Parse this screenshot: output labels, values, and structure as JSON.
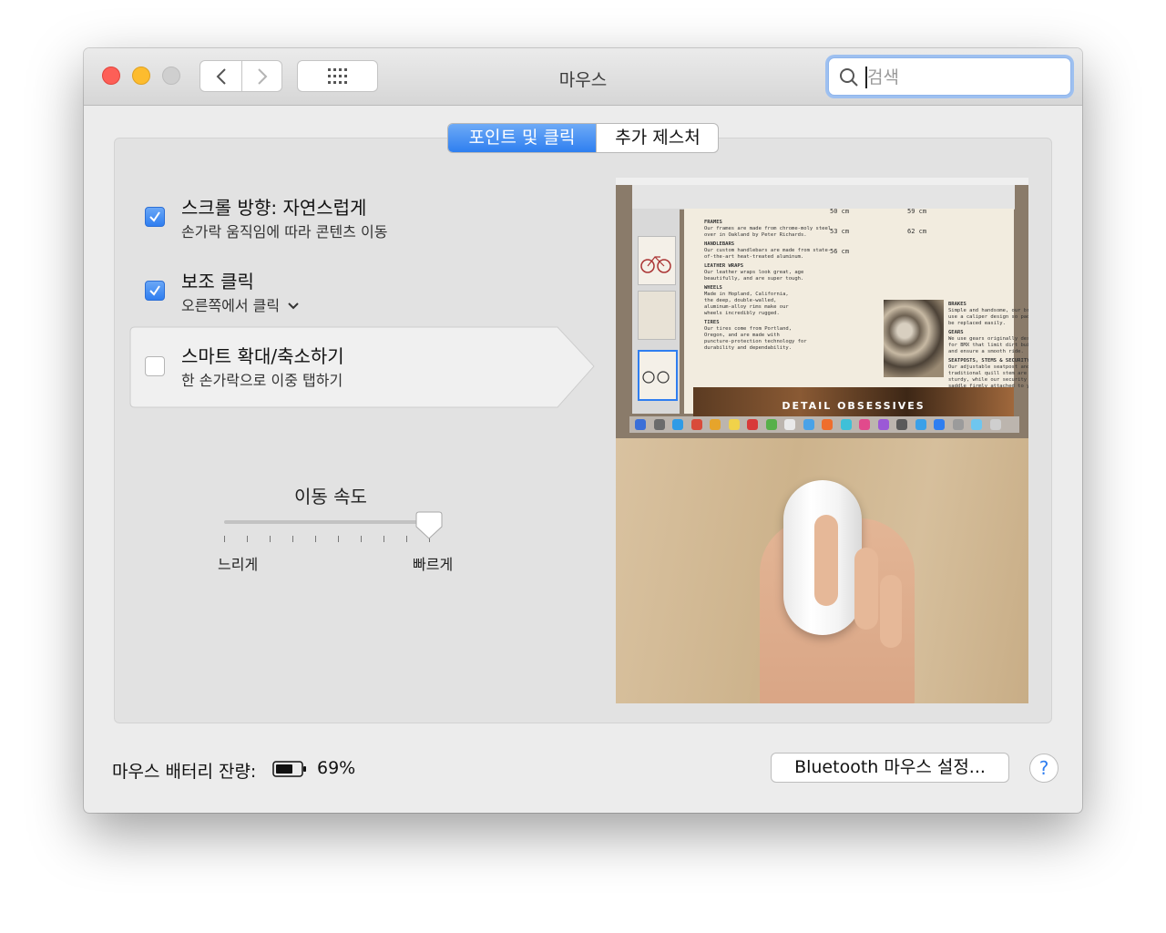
{
  "window": {
    "title": "마우스"
  },
  "toolbar": {
    "back_icon": "chevron-left-icon",
    "forward_icon": "chevron-right-icon",
    "grid_icon": "grid-icon",
    "search_placeholder": "검색",
    "search_icon": "search-icon"
  },
  "tabs": [
    {
      "label": "포인트 및 클릭",
      "active": true
    },
    {
      "label": "추가 제스처",
      "active": false
    }
  ],
  "options": [
    {
      "title": "스크롤 방향: 자연스럽게",
      "subtitle": "손가락 움직임에 따라 콘텐츠 이동",
      "checked": true
    },
    {
      "title": "보조 클릭",
      "subtitle": "오른쪽에서 클릭",
      "checked": true,
      "has_dropdown": true
    },
    {
      "title": "스마트 확대/축소하기",
      "subtitle": "한 손가락으로 이중 탭하기",
      "checked": false
    }
  ],
  "tracking_speed": {
    "label": "이동 속도",
    "min_label": "느리게",
    "max_label": "빠르게",
    "value_fraction": 1.0,
    "tick_count": 10
  },
  "preview": {
    "banner_text": "DETAIL OBSESSIVES",
    "doc_sections": [
      {
        "heading": "FRAMES",
        "lines": [
          "Our frames are made from chrome-moly steel",
          "over in Oakland by Peter Richards."
        ]
      },
      {
        "heading": "HANDLEBARS",
        "lines": [
          "Our custom handlebars are made from state-",
          "of-the-art heat-treated aluminum."
        ]
      },
      {
        "heading": "LEATHER WRAPS",
        "lines": [
          "Our leather wraps look great, age",
          "beautifully, and are super tough."
        ]
      },
      {
        "heading": "WHEELS",
        "lines": [
          "Made in Hopland, California,",
          "the deep, double-walled,",
          "aluminum-alloy rims make our",
          "wheels incredibly rugged."
        ]
      },
      {
        "heading": "TIRES",
        "lines": [
          "Our tires come from Portland,",
          "Oregon, and are made with",
          "puncture-protection technology for",
          "durability and dependability."
        ]
      }
    ],
    "doc_right_sections": [
      {
        "heading": "BRAKES",
        "lines": [
          "Simple and handsome, our brakes",
          "use a caliper design so pads can",
          "be replaced easily."
        ]
      },
      {
        "heading": "GEARS",
        "lines": [
          "We use gears originally designed",
          "for BMX that limit dirt buildup",
          "and ensure a smooth ride."
        ]
      },
      {
        "heading": "SEATPOSTS, STEMS & SECURITY",
        "lines": [
          "Our adjustable seatpost and",
          "traditional quill stem are stylishly",
          "sturdy, while our security bolts keep your",
          "saddle firmly attached to your bike."
        ]
      }
    ],
    "sizes": [
      "50 cm",
      "53 cm",
      "56 cm",
      "59 cm",
      "62 cm"
    ]
  },
  "footer": {
    "battery_label": "마우스 배터리 잔량:",
    "battery_value": "69%",
    "battery_level": 0.69,
    "bluetooth_button": "Bluetooth 마우스 설정...",
    "help_label": "?"
  }
}
